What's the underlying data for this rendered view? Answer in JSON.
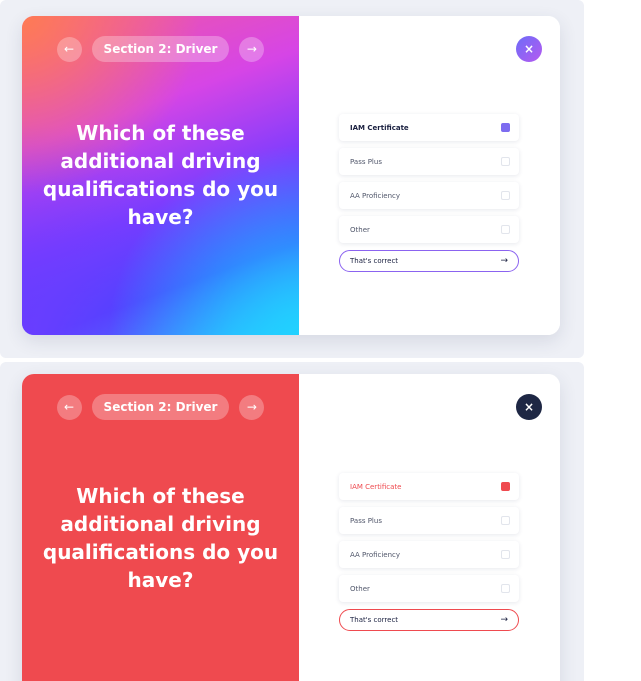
{
  "cards": [
    {
      "theme": "gradient",
      "section_label": "Section 2: Driver",
      "prev_icon": "←",
      "next_icon": "→",
      "close_icon": "×",
      "question": "Which of these additional driving qualifications do you have?",
      "options": [
        {
          "label": "IAM Certificate",
          "selected": true
        },
        {
          "label": "Pass Plus",
          "selected": false
        },
        {
          "label": "AA Proficiency",
          "selected": false
        },
        {
          "label": "Other",
          "selected": false
        }
      ],
      "confirm_label": "That's correct",
      "confirm_icon": "→",
      "colors": {
        "accent": "#8b63f0",
        "gradient_start": "#f56b6b",
        "gradient_end": "#2fc6ff"
      }
    },
    {
      "theme": "red",
      "section_label": "Section 2: Driver",
      "prev_icon": "←",
      "next_icon": "→",
      "close_icon": "×",
      "question": "Which of these additional driving qualifications do you have?",
      "options": [
        {
          "label": "IAM Certificate",
          "selected": true
        },
        {
          "label": "Pass Plus",
          "selected": false
        },
        {
          "label": "AA Proficiency",
          "selected": false
        },
        {
          "label": "Other",
          "selected": false
        }
      ],
      "confirm_label": "That's correct",
      "confirm_icon": "→",
      "colors": {
        "accent": "#ef4a4f",
        "close_button": "#1e2744"
      }
    }
  ]
}
